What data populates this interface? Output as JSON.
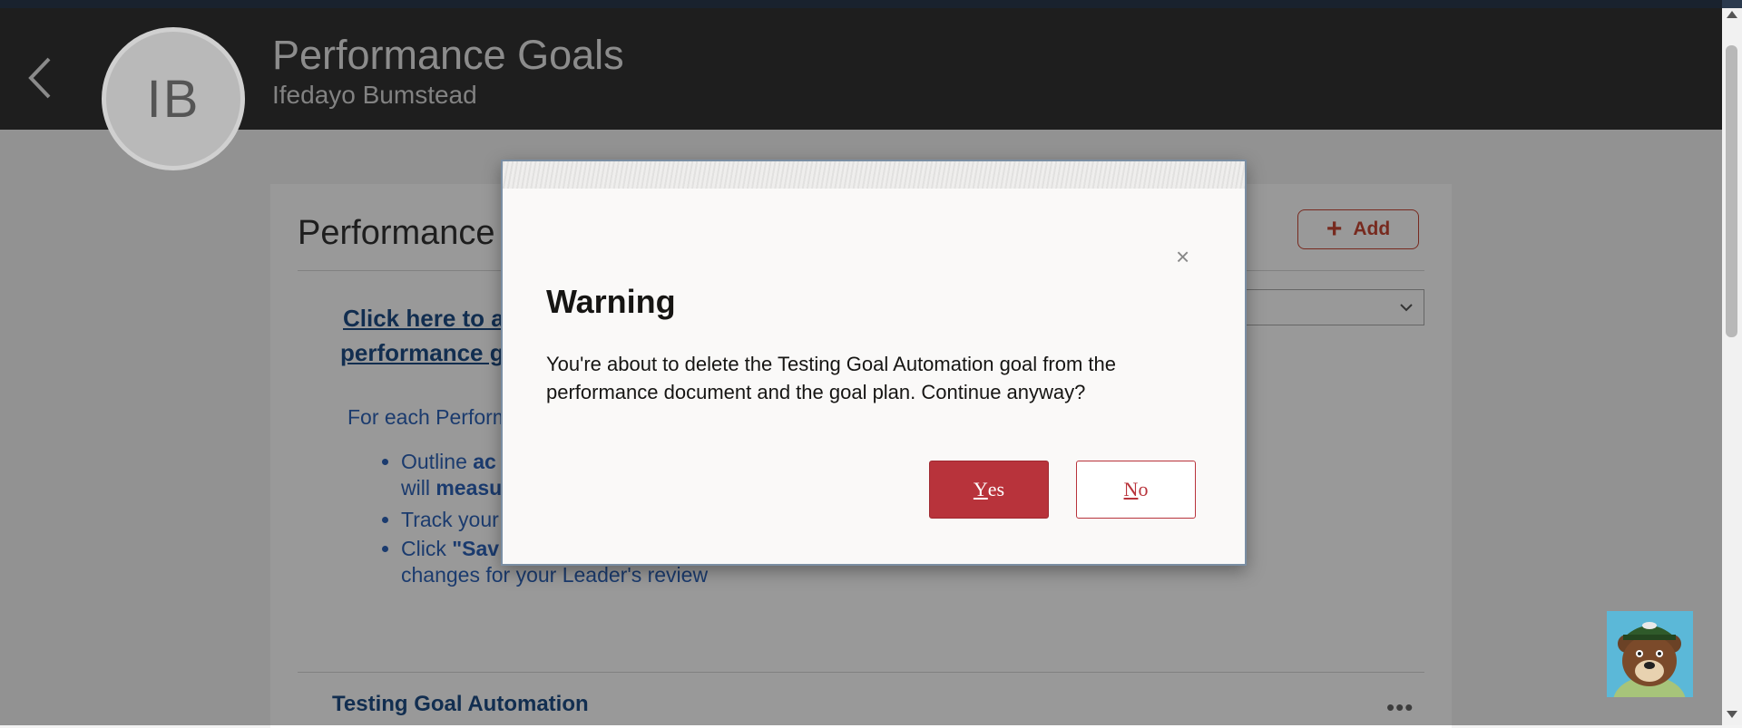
{
  "header": {
    "avatar_initials": "IB",
    "title": "Performance Goals",
    "subtitle": "Ifedayo Bumstead"
  },
  "card": {
    "title": "Performance G",
    "add_label": "Add",
    "link_line1": "Click here to a",
    "link_line2": "performance g",
    "intro": "For each Perform",
    "bullets": [
      {
        "lead": "Outline ",
        "bold": "ac",
        "cont_lead": "will ",
        "cont_bold": "measu"
      },
      {
        "lead": "Track your"
      },
      {
        "lead": "Click ",
        "bold": "\"Sav",
        "cont_lead": "changes for your Leader's review"
      }
    ],
    "goal_name": "Testing Goal Automation",
    "more_label": "•••"
  },
  "dialog": {
    "close_label": "×",
    "title": "Warning",
    "message": "You're about to delete the Testing Goal Automation goal from the performance document and the goal plan. Continue anyway?",
    "yes_accel": "Y",
    "yes_rest": "es",
    "no_accel": "N",
    "no_rest": "o"
  },
  "colors": {
    "header_bg": "#333333",
    "accent_red": "#b8333b",
    "link_blue": "#1e4e86",
    "text_blue": "#2e63b8"
  }
}
